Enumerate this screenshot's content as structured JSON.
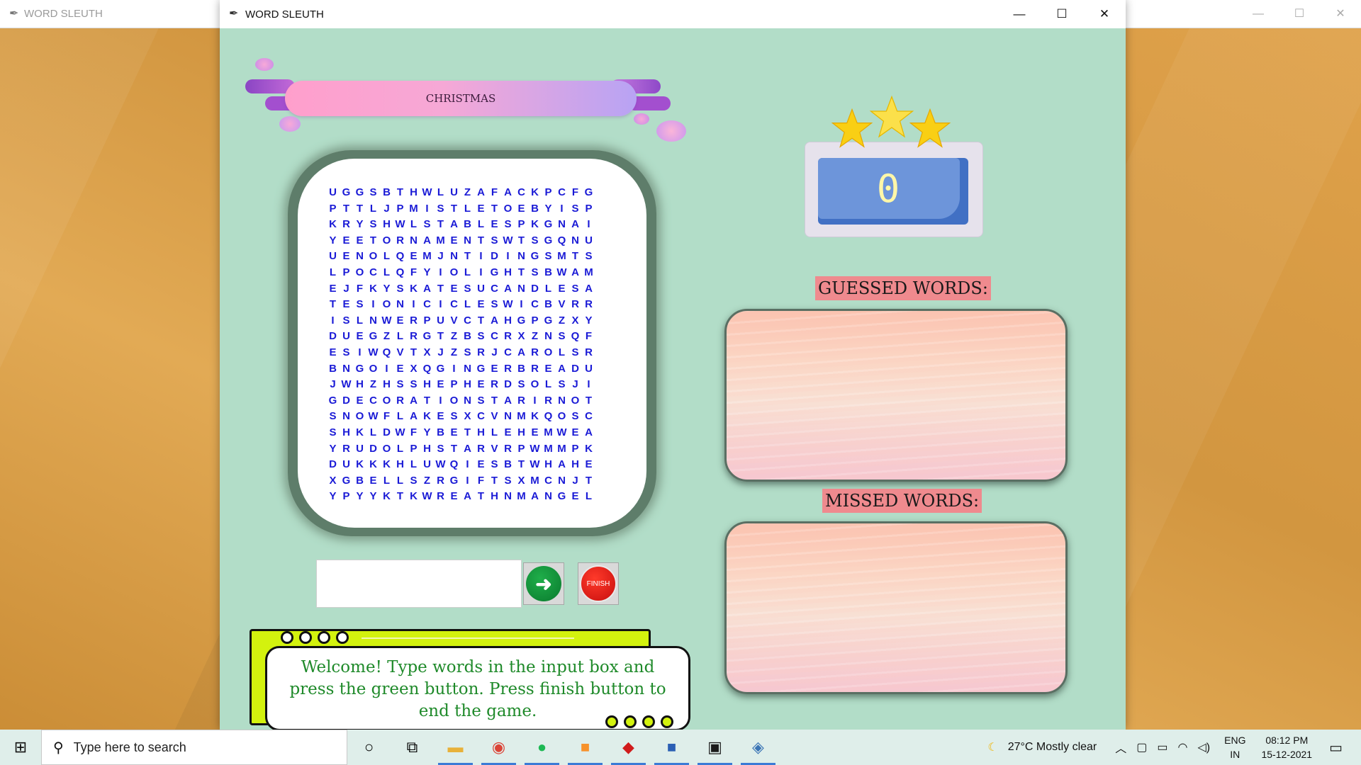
{
  "back_window": {
    "title": "WORD SLEUTH",
    "icon": "feather-icon"
  },
  "window": {
    "title": "WORD SLEUTH",
    "icon": "feather-icon",
    "controls": {
      "minimize": "—",
      "maximize": "☐",
      "close": "✕"
    }
  },
  "category": "CHRISTMAS",
  "grid": [
    "UGGSBTHWLUZAFACKPCFG",
    "PTTLJPMISTLETOEBYISP",
    "KRYSHWLSTABLESPKGNAI",
    "YEETORNAMENTSWTSGQNU",
    "UENOLQEMJNTIDINGSMTS",
    "LPOCLQFYIOLIGHTSBWAM",
    "EJFKYSKATESUCANDLESA",
    "TESIONICICLESWICBVRR",
    "ISLNWERPUVCTAHGPGZXY",
    "DUEGZLRGTZBSCRXZNSQF",
    "ESIWQVTXJZSRJCAROLSR",
    "BNGOIEXQGINGERBREADU",
    "JWHZHSSHEPHERDSOLSJI",
    "GDECORATIONSTARIRNOT",
    "SNOWFLAKESXCVNMKQOSC",
    "SHKLDWFYBETHLEHEMWEA",
    "YRUDOLPHSTARVRPWMMPK",
    "DUKKKHLUWQIESBTWHAHE",
    "XGBELLSZRGIFTSXMCNJT",
    "YPYYKTKWREATHNMANGEL"
  ],
  "input": {
    "value": "",
    "placeholder": ""
  },
  "buttons": {
    "go_icon": "arrow-right-icon",
    "go_glyph": "➜",
    "finish_label": "FINISH"
  },
  "message": "Welcome! Type words in the input box and press the green button. Press finish button to end the game.",
  "score": {
    "value": "0"
  },
  "guessed_label": "GUESSED WORDS:",
  "missed_label": "MISSED WORDS:",
  "taskbar": {
    "search_placeholder": "Type here to search",
    "apps": [
      "cortana-icon",
      "task-view-icon",
      "file-explorer-icon",
      "chrome-icon",
      "spotify-icon",
      "sublime-text-icon",
      "acrobat-icon",
      "word-icon",
      "terminal-icon",
      "python-icon"
    ],
    "weather": "27°C  Mostly clear",
    "lang_top": "ENG",
    "lang_bottom": "IN",
    "time": "08:12 PM",
    "date": "15-12-2021"
  },
  "colors": {
    "window_bg": "#b2ddc8",
    "grid_letters": "#1a1ad6",
    "message_text": "#1f8a2a",
    "label_bg": "#ef8a8e",
    "score_screen": "#6d95da"
  }
}
